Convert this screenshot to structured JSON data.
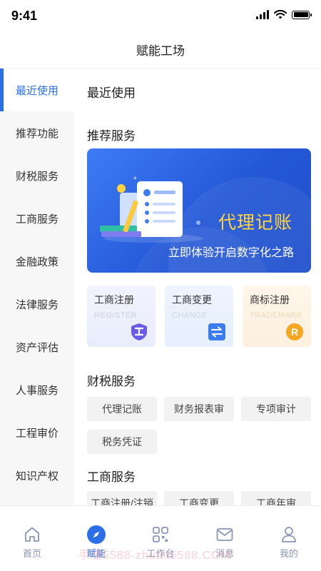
{
  "status_bar": {
    "time": "9:41"
  },
  "nav": {
    "title": "赋能工场"
  },
  "sidebar": {
    "items": [
      {
        "label": "最近使用",
        "active": true
      },
      {
        "label": "推荐功能"
      },
      {
        "label": "财税服务"
      },
      {
        "label": "工商服务"
      },
      {
        "label": "金融政策"
      },
      {
        "label": "法律服务"
      },
      {
        "label": "资产评估"
      },
      {
        "label": "人事服务"
      },
      {
        "label": "工程审价"
      },
      {
        "label": "知识产权"
      }
    ]
  },
  "main": {
    "recent_title": "最近使用",
    "recommend_title": "推荐服务",
    "banner": {
      "title": "代理记账",
      "subtitle": "立即体验开启数字化之路"
    },
    "cards": [
      {
        "title": "工商注册",
        "subtitle": "REGISTER",
        "icon": "shield-icon",
        "icon_color": "#6b5ce7"
      },
      {
        "title": "工商变更",
        "subtitle": "CHANGE",
        "icon": "swap-icon",
        "icon_color": "#3b7cf0"
      },
      {
        "title": "商标注册",
        "subtitle": "TRADEMARK",
        "icon": "trademark-icon",
        "icon_color": "#f5a623"
      }
    ],
    "tax_title": "财税服务",
    "tax_tags": [
      "代理记账",
      "财务报表审",
      "专项审计",
      "税务凭证"
    ],
    "biz_title": "工商服务",
    "biz_tags": [
      "工商注册/注销",
      "工商变更",
      "工商年审"
    ]
  },
  "tabbar": {
    "tabs": [
      {
        "label": "首页",
        "icon": "home-icon"
      },
      {
        "label": "赋能",
        "icon": "compass-icon",
        "active": true
      },
      {
        "label": "工作台",
        "icon": "grid-icon"
      },
      {
        "label": "消息",
        "icon": "mail-icon"
      },
      {
        "label": "我的",
        "icon": "user-icon"
      }
    ]
  },
  "watermark": "手赚5588-zhuan5588.COM",
  "colors": {
    "accent": "#2a6fe8",
    "banner_title": "#ffd33d"
  }
}
